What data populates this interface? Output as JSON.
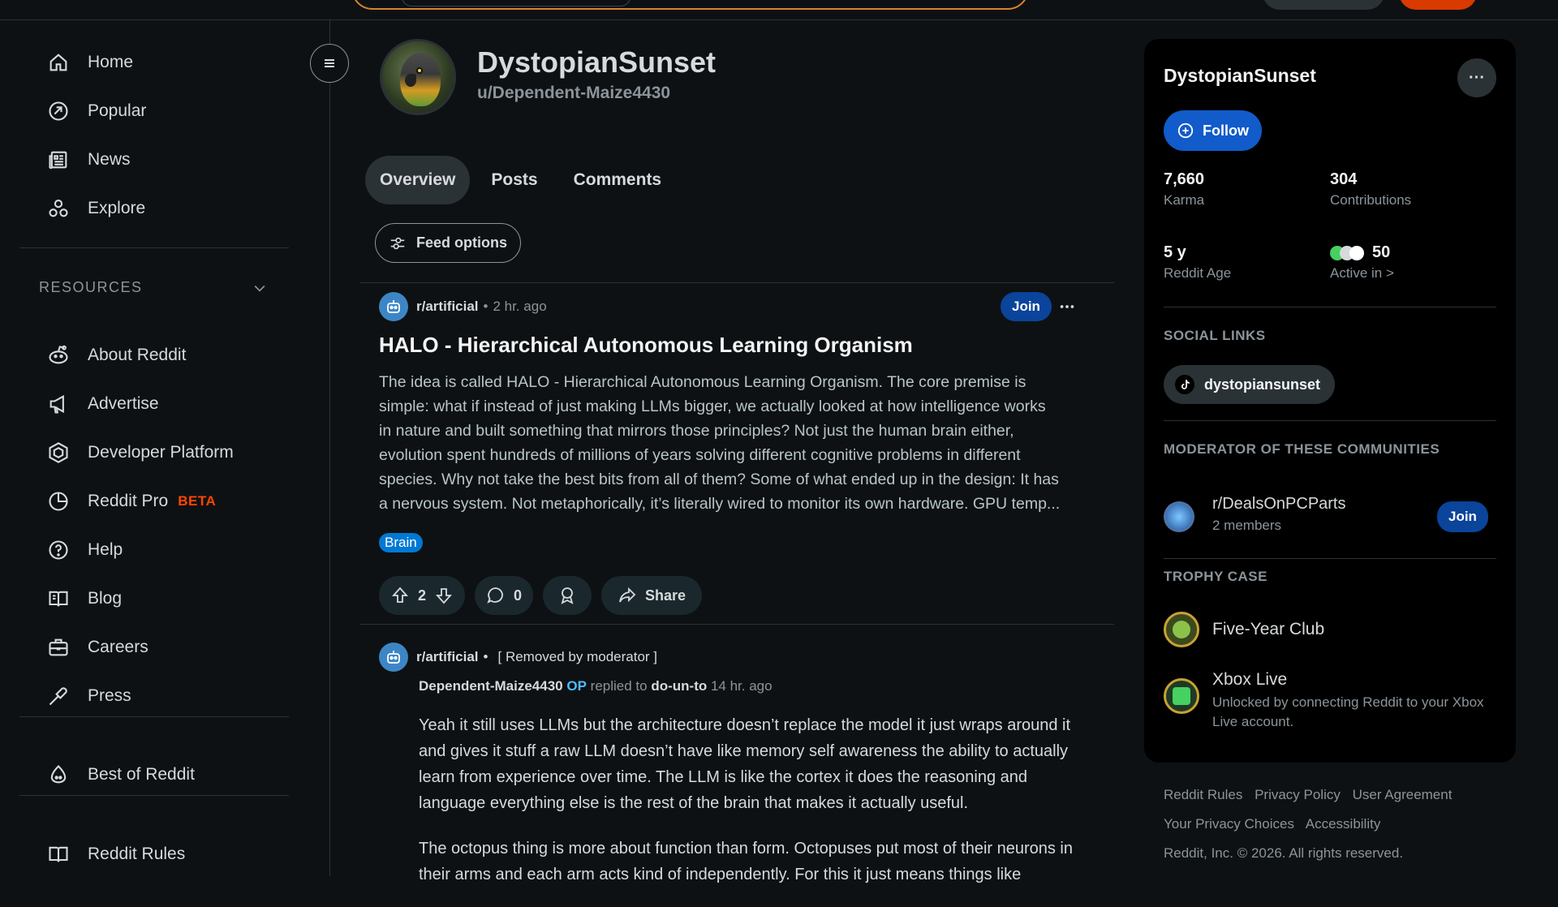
{
  "sidebar": {
    "nav": [
      {
        "label": "Home",
        "icon": "home-icon"
      },
      {
        "label": "Popular",
        "icon": "popular-icon"
      },
      {
        "label": "News",
        "icon": "news-icon"
      },
      {
        "label": "Explore",
        "icon": "explore-icon"
      }
    ],
    "resources_heading": "RESOURCES",
    "resources": [
      {
        "label": "About Reddit",
        "icon": "reddit-alien-icon"
      },
      {
        "label": "Advertise",
        "icon": "megaphone-icon"
      },
      {
        "label": "Developer Platform",
        "icon": "developer-platform-icon"
      },
      {
        "label": "Reddit Pro",
        "badge": "BETA",
        "icon": "reddit-pro-icon"
      },
      {
        "label": "Help",
        "icon": "help-icon"
      },
      {
        "label": "Blog",
        "icon": "blog-icon"
      },
      {
        "label": "Careers",
        "icon": "careers-icon"
      },
      {
        "label": "Press",
        "icon": "press-icon"
      }
    ],
    "best_of": {
      "label": "Best of Reddit",
      "icon": "best-of-reddit-icon"
    },
    "rules": {
      "label": "Reddit Rules",
      "icon": "rules-icon"
    }
  },
  "profile": {
    "display_name": "DystopianSunset",
    "username": "u/Dependent-Maize4430"
  },
  "tabs": [
    "Overview",
    "Posts",
    "Comments"
  ],
  "active_tab": "Overview",
  "feed_options_label": "Feed options",
  "post": {
    "subreddit": "r/artificial",
    "time": "2 hr. ago",
    "join_label": "Join",
    "title": "HALO - Hierarchical Autonomous Learning Organism",
    "body_lines": [
      "The idea is called HALO - Hierarchical Autonomous Learning Organism. The core premise is",
      "simple: what if instead of just making LLMs bigger, we actually looked at how intelligence works",
      "in nature and built something that mirrors those principles? Not just the human brain either,",
      "evolution spent hundreds of millions of years solving different cognitive problems in different",
      "species. Why not take the best bits from all of them? Some of what ended up in the design: It has",
      "a nervous system. Not metaphorically, it’s literally wired to monitor its own hardware. GPU temp..."
    ],
    "flair": "Brain",
    "votes": "2",
    "comments": "0",
    "share_label": "Share"
  },
  "comment": {
    "subreddit": "r/artificial",
    "removed": "[ Removed by moderator ]",
    "author": "Dependent-Maize4430",
    "op": "OP",
    "replied_to_text": "replied to",
    "replied_to": "do-un-to",
    "time": "14 hr. ago",
    "paragraphs": [
      "Yeah it still uses LLMs but the architecture doesn’t replace the model it just wraps around it and gives it stuff a raw LLM doesn’t have like memory self awareness the ability to actually learn from experience over time. The LLM is like the cortex it does the reasoning and language everything else is the rest of the brain that makes it actually useful.",
      "The octopus thing is more about function than form. Octopuses put most of their neurons in their arms and each arm acts kind of independently. For this it just means things like"
    ]
  },
  "right_panel": {
    "display_name": "DystopianSunset",
    "more": "···",
    "follow_label": "Follow",
    "stats": [
      {
        "value": "7,660",
        "label": "Karma"
      },
      {
        "value": "304",
        "label": "Contributions"
      },
      {
        "value": "5 y",
        "label": "Reddit Age"
      },
      {
        "value": "50",
        "label": "Active in >"
      }
    ],
    "social_heading": "SOCIAL LINKS",
    "social_link": "dystopiansunset",
    "mod_heading": "MODERATOR OF THESE COMMUNITIES",
    "community": {
      "name": "r/DealsOnPCParts",
      "members": "2 members",
      "join_label": "Join"
    },
    "trophy_heading": "TROPHY CASE",
    "trophies": [
      {
        "name": "Five-Year Club"
      },
      {
        "name": "Xbox Live",
        "desc": "Unlocked by connecting Reddit to your Xbox Live account."
      }
    ]
  },
  "footer": {
    "links": [
      "Reddit Rules",
      "Privacy Policy",
      "User Agreement",
      "Your Privacy Choices",
      "Accessibility"
    ],
    "copyright": "Reddit, Inc. © 2026. All rights reserved."
  },
  "colors": {
    "background": "#0e1113",
    "accent_blue": "#0a449b",
    "follow_blue": "#115bca",
    "beta_orange": "#ff4500",
    "flair_blue": "#0079d3"
  }
}
